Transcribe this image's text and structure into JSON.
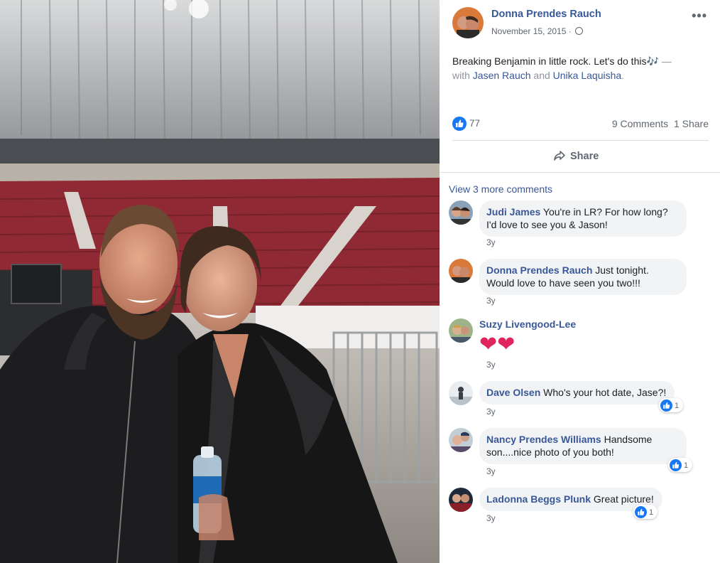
{
  "post": {
    "author": "Donna Prendes Rauch",
    "date": "November 15, 2015",
    "date_sep": "·",
    "more_icon": "more-options-icon",
    "text_main": "Breaking Benjamin in little rock. Let's do this🎶",
    "text_dash": " — ",
    "text_with": "with ",
    "tag1": "Jasen Rauch",
    "text_and": " and ",
    "tag2": "Unika Laquisha",
    "text_end": "."
  },
  "stats": {
    "likes": "77",
    "comments": "9 Comments",
    "shares": "1 Share"
  },
  "actions": {
    "share_label": "Share"
  },
  "comments_section": {
    "view_more": "View 3 more comments",
    "items": [
      {
        "name": "Judi James",
        "text": " You're in LR? For how long? I'd love to see you & Jason!",
        "time": "3y",
        "reactions": ""
      },
      {
        "name": "Donna Prendes Rauch",
        "text": " Just tonight. Would love to have seen you two!!!",
        "time": "3y",
        "reactions": ""
      },
      {
        "name": "Suzy Livengood-Lee",
        "text": "❤❤",
        "time": "3y",
        "reactions": ""
      },
      {
        "name": "Dave Olsen",
        "text": " Who's your hot date, Jase?!",
        "time": "3y",
        "reactions": "1"
      },
      {
        "name": "Nancy Prendes Williams",
        "text": " Handsome son....nice photo of you both!",
        "time": "3y",
        "reactions": "1"
      },
      {
        "name": "Ladonna Beggs Plunk",
        "text": " Great picture!",
        "time": "3y",
        "reactions": "1"
      }
    ]
  },
  "colors": {
    "link": "#385898",
    "like_blue": "#1877f2",
    "bubble": "#f2f3f5",
    "heart": "#e0245e"
  }
}
